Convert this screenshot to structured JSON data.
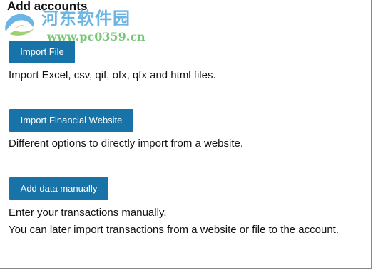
{
  "page": {
    "title": "Add accounts"
  },
  "options": [
    {
      "button_label": "Import File",
      "description": [
        "Import Excel, csv, qif, ofx, qfx and html files."
      ]
    },
    {
      "button_label": "Import Financial Website",
      "description": [
        "Different options to directly import from a website."
      ]
    },
    {
      "button_label": "Add data manually",
      "description": [
        "Enter your transactions manually.",
        "You can later import transactions from a website or file to the account."
      ]
    }
  ],
  "watermark": {
    "site_name": "河东软件园",
    "url": "www.pc0359.cn",
    "icon": "swirl-logo-icon"
  },
  "colors": {
    "button_bg": "#1874a8",
    "button_text": "#ffffff",
    "border": "#8a8a8a"
  }
}
